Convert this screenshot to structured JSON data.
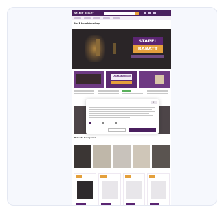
{
  "site": {
    "logo": "SELECT BRIGHT",
    "page_heading": "Nr. 1 Leuchtenshop",
    "hero": {
      "line1": "STAPEL",
      "line2": "RABATT"
    },
    "promo_middle": {
      "label": "LAGERABVERKAUF"
    },
    "section_title": "Beliebte Kategorien"
  },
  "colors": {
    "brand_purple": "#4a1f5e",
    "accent_orange": "#e4a03c",
    "page_background": "#f6f8fd"
  },
  "icons": [
    "search-icon",
    "user-icon",
    "heart-icon",
    "cart-icon",
    "chat-icon",
    "close-icon",
    "checkbox-icon"
  ],
  "cookie_dialog": {
    "close_label": "×"
  }
}
